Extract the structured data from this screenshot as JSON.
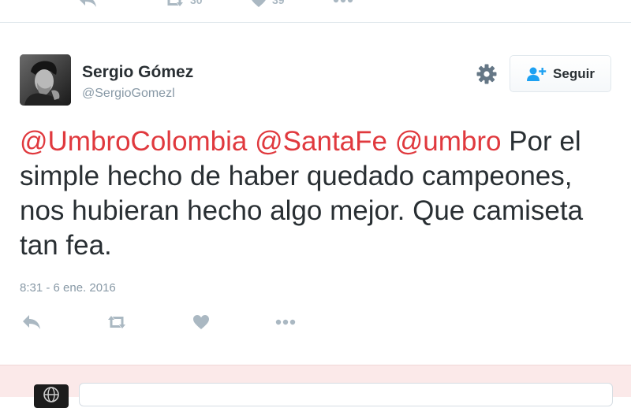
{
  "top_actions": {
    "retweet_count": "30",
    "like_count": "39"
  },
  "tweet": {
    "author_name": "Sergio Gómez",
    "author_handle": "@SergioGomezl",
    "follow_label": "Seguir",
    "text_segments": [
      {
        "type": "mention",
        "text": "@UmbroColombia"
      },
      {
        "type": "text",
        "text": " "
      },
      {
        "type": "mention",
        "text": "@SantaFe"
      },
      {
        "type": "text",
        "text": " "
      },
      {
        "type": "mention",
        "text": "@umbro"
      },
      {
        "type": "text",
        "text": " Por el simple hecho de haber quedado campeones, nos hubieran hecho algo mejor. Que camiseta tan fea."
      }
    ],
    "timestamp": "8:31 - 6 ene. 2016"
  },
  "icons": {
    "reply": "reply-icon",
    "retweet": "retweet-icon",
    "like": "heart-icon",
    "more": "more-icon",
    "settings": "gear-icon",
    "follow": "follow-user-icon"
  },
  "colors": {
    "mention": "#e0393e",
    "icon": "#aab8c2",
    "muted_text": "#8899a6",
    "follow_icon": "#1da1f2",
    "reply_area_bg": "#fbe9e9"
  }
}
